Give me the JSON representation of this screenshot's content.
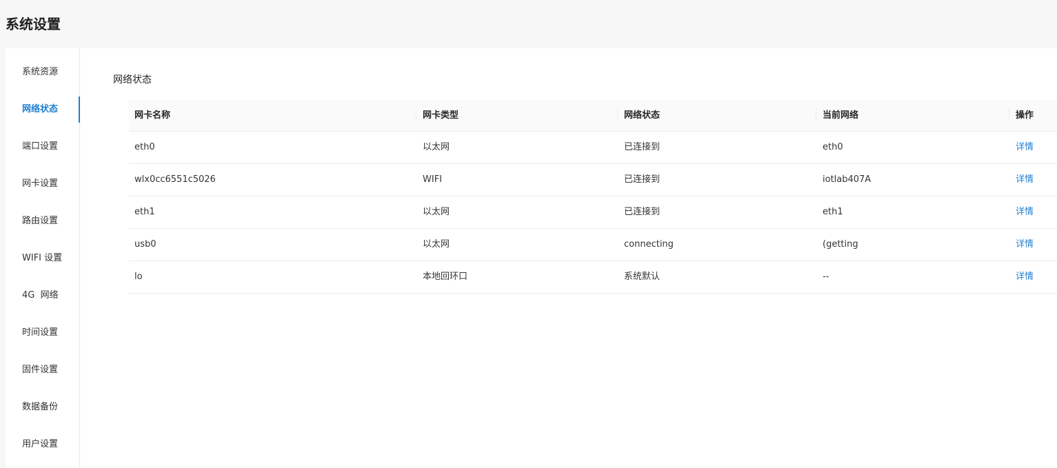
{
  "header": {
    "title": "系统设置"
  },
  "sidebar": {
    "active_index": 1,
    "items": [
      {
        "label": "系统资源"
      },
      {
        "label": "网络状态"
      },
      {
        "label": "端口设置"
      },
      {
        "label": "网卡设置"
      },
      {
        "label": "路由设置"
      },
      {
        "label": "WIFI 设置"
      },
      {
        "label": "4G  网络"
      },
      {
        "label": "时间设置"
      },
      {
        "label": "固件设置"
      },
      {
        "label": "数据备份"
      },
      {
        "label": "用户设置"
      }
    ]
  },
  "main": {
    "section_title": "网络状态",
    "table": {
      "columns": [
        "网卡名称",
        "网卡类型",
        "网络状态",
        "当前网络",
        "操作"
      ],
      "rows": [
        {
          "name": "eth0",
          "type": "以太网",
          "status": "已连接到",
          "network": "eth0",
          "action": "详情"
        },
        {
          "name": "wlx0cc6551c5026",
          "type": "WIFI",
          "status": "已连接到",
          "network": "iotlab407A",
          "action": "详情"
        },
        {
          "name": "eth1",
          "type": "以太网",
          "status": "已连接到",
          "network": "eth1",
          "action": "详情"
        },
        {
          "name": "usb0",
          "type": "以太网",
          "status": "connecting",
          "network": "(getting",
          "action": "详情"
        },
        {
          "name": "lo",
          "type": "本地回环口",
          "status": "系统默认",
          "network": "--",
          "action": "详情"
        }
      ]
    }
  },
  "colors": {
    "accent": "#1f7fd0",
    "page_bg": "#f7f7f8",
    "panel_bg": "#ffffff",
    "table_header_bg": "#fafafa"
  }
}
